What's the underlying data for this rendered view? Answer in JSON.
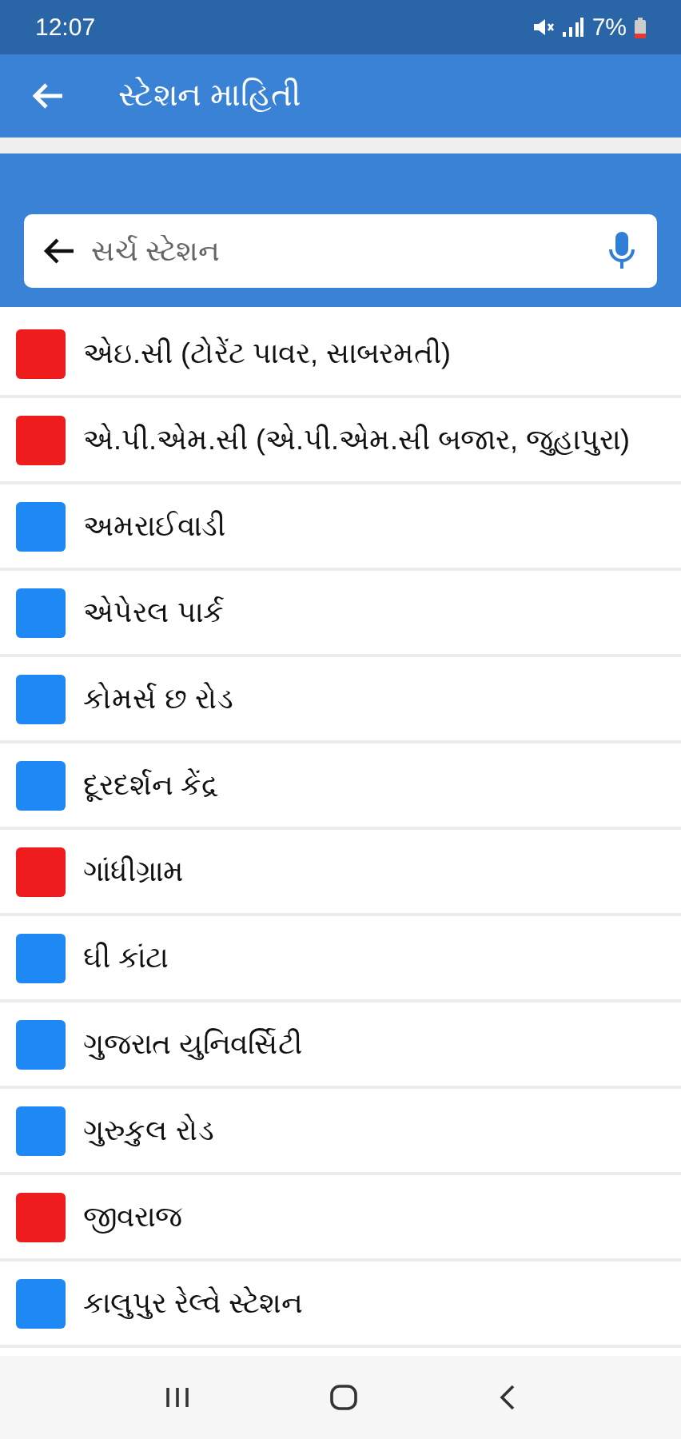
{
  "status_bar": {
    "time": "12:07",
    "battery": "7%"
  },
  "app_bar": {
    "title": "સ્ટેશન માહિતી"
  },
  "search": {
    "placeholder": "સર્ચ સ્ટેશન"
  },
  "stations": [
    {
      "name": "એઇ.સી (ટોરેંટ પાવર, સાબરમતી)",
      "color": "#ee1c1c"
    },
    {
      "name": "એ.પી.એમ.સી (એ.પી.એમ.સી બજાર, જુહાપુરા)",
      "color": "#ee1c1c"
    },
    {
      "name": "અમરાઈવાડી",
      "color": "#1e88f5"
    },
    {
      "name": "એપેરલ પાર્ક",
      "color": "#1e88f5"
    },
    {
      "name": "કોમર્સ છ રોડ",
      "color": "#1e88f5"
    },
    {
      "name": "દૂરદર્શન કેંદ્ર",
      "color": "#1e88f5"
    },
    {
      "name": "ગાંધીગ્રામ",
      "color": "#ee1c1c"
    },
    {
      "name": "ઘી કાંટા",
      "color": "#1e88f5"
    },
    {
      "name": "ગુજરાત યુનિવર્સિટી",
      "color": "#1e88f5"
    },
    {
      "name": "ગુરુકુલ રોડ",
      "color": "#1e88f5"
    },
    {
      "name": "જીવરાજ",
      "color": "#ee1c1c"
    },
    {
      "name": "કાલુપુર રેલ્વે સ્ટેશન",
      "color": "#1e88f5"
    }
  ]
}
